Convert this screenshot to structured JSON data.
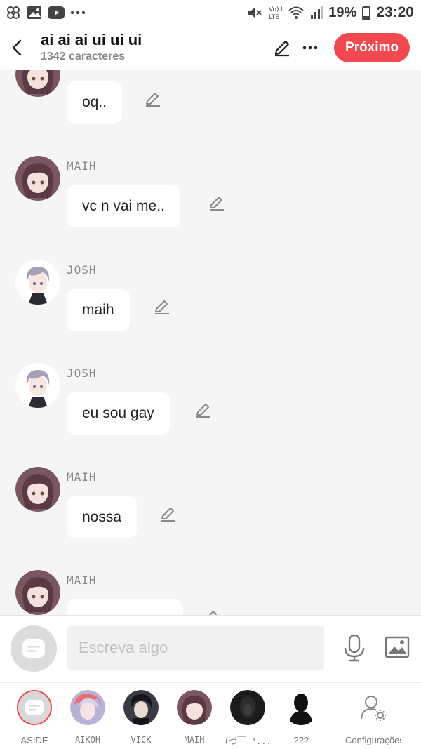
{
  "status_bar": {
    "battery": "19%",
    "time": "23:20",
    "network_label": "Vo) LTE"
  },
  "header": {
    "title": "ai ai ai ui ui ui",
    "subtitle": "1342 caracteres",
    "next_label": "Próximo"
  },
  "messages": [
    {
      "sender": "",
      "text": "oq..",
      "avatar": "maih"
    },
    {
      "sender": "MAIH",
      "text": "vc n vai me..",
      "avatar": "maih"
    },
    {
      "sender": "JOSH",
      "text": "maih",
      "avatar": "josh"
    },
    {
      "sender": "JOSH",
      "text": "eu sou gay",
      "avatar": "josh"
    },
    {
      "sender": "MAIH",
      "text": "nossa",
      "avatar": "maih"
    },
    {
      "sender": "MAIH",
      "text": "",
      "avatar": "maih"
    }
  ],
  "composer": {
    "placeholder": "Escreva algo"
  },
  "characters": [
    {
      "name": "ASIDE",
      "avatar": "aside"
    },
    {
      "name": "AIKOH",
      "avatar": "aikoh"
    },
    {
      "name": "VICK",
      "avatar": "vick"
    },
    {
      "name": "MAIH",
      "avatar": "maih"
    },
    {
      "name": "(づ￣ ³...",
      "avatar": "dark"
    },
    {
      "name": "???",
      "avatar": "silhouette"
    },
    {
      "name": "Configurações",
      "avatar": "settings"
    }
  ],
  "colors": {
    "accent": "#f2484f",
    "bubble": "#ffffff",
    "background": "#f5f5f5"
  }
}
